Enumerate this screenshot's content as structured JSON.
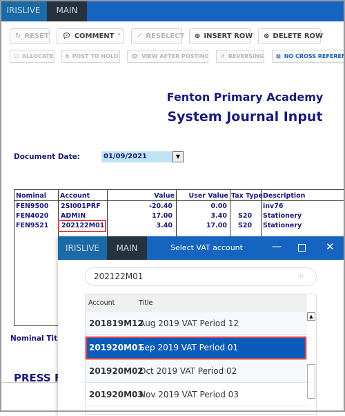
{
  "tabs": {
    "irislive": "IRISLIVE",
    "main": "MAIN"
  },
  "toolbar": {
    "reset": "RESET",
    "comment": "COMMENT",
    "reselect": "RESELECT",
    "insert_row": "INSERT ROW",
    "delete_row": "DELETE ROW",
    "allocate": "ALLOCATE",
    "post_to_hold": "POST TO HOLD",
    "view_after_posting": "VIEW AFTER POSTING",
    "reversing": "REVERSING",
    "no_cross_reference": "NO CROSS REFERENCE"
  },
  "header": {
    "org": "Fenton Primary Academy",
    "title": "System Journal Input"
  },
  "document_date": {
    "label": "Document Date:",
    "value": "01/09/2021"
  },
  "table": {
    "headers": [
      "Nominal",
      "Account",
      "Value",
      "User Value",
      "Tax Type",
      "Description"
    ],
    "rows": [
      [
        "FEN9500",
        "2SI001PRF",
        "-20.40",
        "0.00",
        "",
        "inv76"
      ],
      [
        "FEN4020",
        "ADMIN",
        "17.00",
        "3.40",
        "S20",
        "Stationery"
      ],
      [
        "FEN9521",
        "202122M01",
        "3.40",
        "17.00",
        "S20",
        "Stationery"
      ]
    ]
  },
  "nominal_title_label": "Nominal Titl",
  "press_label": "PRESS F",
  "dialog": {
    "tabs": {
      "irislive": "IRISLIVE",
      "main": "MAIN"
    },
    "title": "Select VAT account",
    "search_value": "202122M01",
    "columns": [
      "Account",
      "Title"
    ],
    "rows": [
      [
        "201819M12",
        "Aug 2019 VAT Period 12"
      ],
      [
        "201920M01",
        "Sep 2019 VAT Period 01"
      ],
      [
        "201920M02",
        "Oct 2019 VAT Period 02"
      ],
      [
        "201920M03",
        "Nov 2019 VAT Period 03"
      ]
    ],
    "selected_index": 1
  },
  "colors": {
    "blue": "#1565c0",
    "navy": "#1a1a7a",
    "selected": "#0b5cb8",
    "highlight": "#e8434a"
  }
}
